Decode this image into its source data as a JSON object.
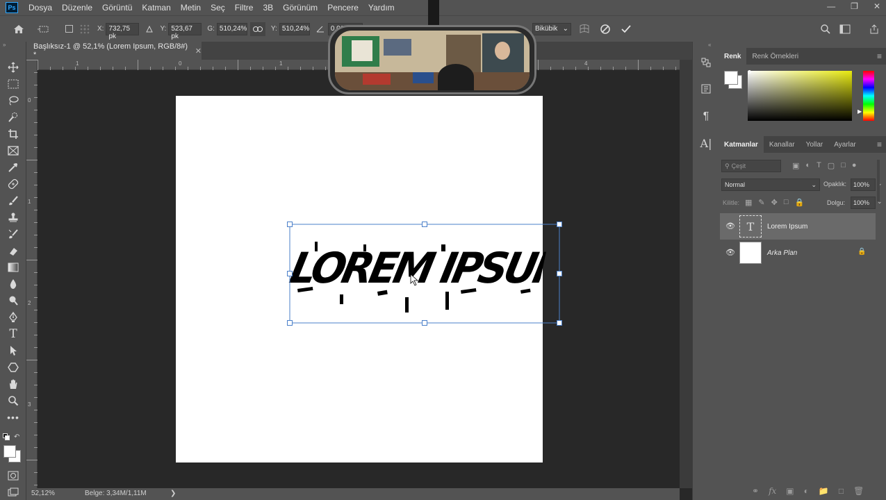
{
  "menubar": {
    "logo": "Ps",
    "items": [
      "Dosya",
      "Düzenle",
      "Görüntü",
      "Katman",
      "Metin",
      "Seç",
      "Filtre",
      "3B",
      "Görünüm",
      "Pencere",
      "Yardım"
    ]
  },
  "options": {
    "x_label": "X:",
    "x_value": "732,75 pk",
    "y_label": "Y:",
    "y_value": "523,67 pk",
    "w_label": "G:",
    "w_value": "510,24%",
    "h_label": "Y:",
    "h_value": "510,24%",
    "angle_value": "0,00",
    "interpolation": "Bikübik"
  },
  "document": {
    "tab_title": "Başlıksız-1 @ 52,1% (Lorem Ipsum, RGB/8#) *",
    "text": "LOREM IPSUM"
  },
  "ruler": {
    "h_numbers": [
      "1",
      "0",
      "1",
      "4"
    ],
    "v_numbers": [
      "0",
      "1",
      "2",
      "3"
    ]
  },
  "status": {
    "zoom": "52,12%",
    "doc_size": "Belge: 3,34M/1,11M",
    "arrow": "❯"
  },
  "color_panel": {
    "tabs": [
      "Renk",
      "Renk Örnekleri"
    ],
    "foreground": "#ffffff",
    "background": "#ffffff",
    "field_hue": "#e8ea10"
  },
  "layers_panel": {
    "tabs": [
      "Katmanlar",
      "Kanallar",
      "Yollar",
      "Ayarlar"
    ],
    "search_placeholder": "Çeşit",
    "blend_mode": "Normal",
    "opacity_label": "Opaklık:",
    "opacity_value": "100%",
    "lock_label": "Kilitle:",
    "fill_label": "Dolgu:",
    "fill_value": "100%",
    "layers": [
      {
        "name": "Lorem Ipsum",
        "type": "text",
        "thumb": "T",
        "selected": true
      },
      {
        "name": "Arka Plan",
        "type": "background",
        "locked": true
      }
    ]
  },
  "colors": {
    "accent": "#31a8ff",
    "selection_box": "#4a7fc9"
  }
}
